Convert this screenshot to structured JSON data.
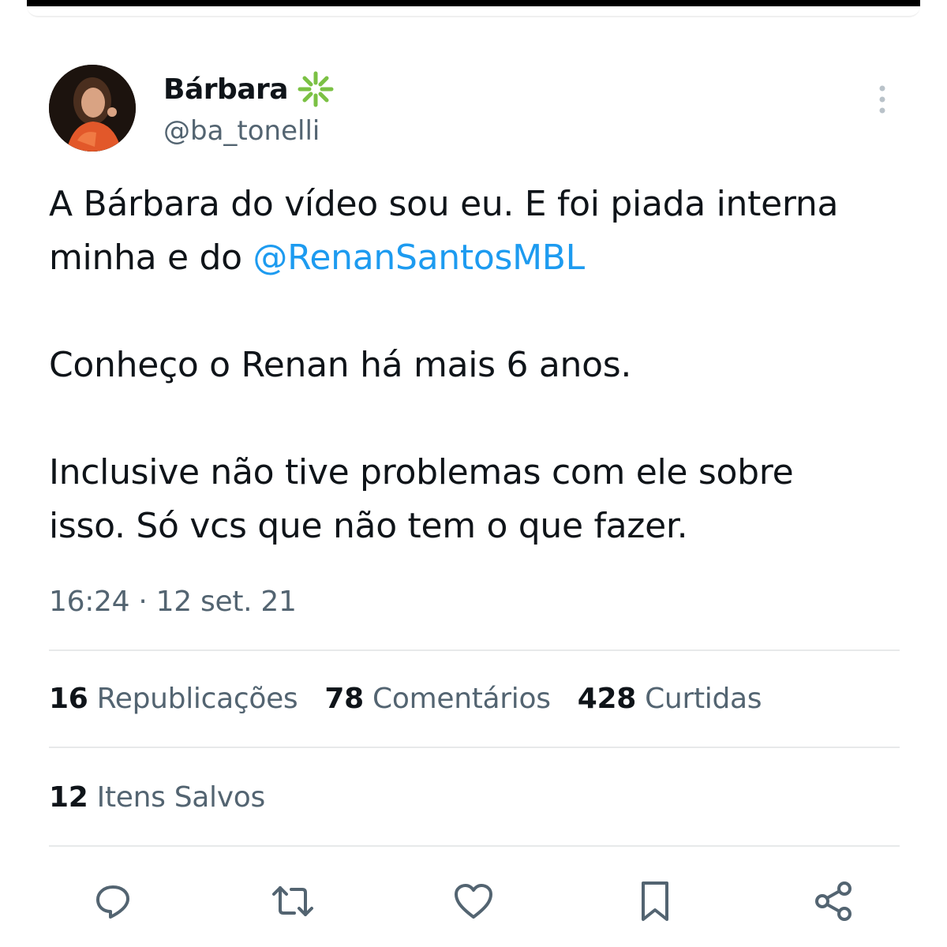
{
  "author": {
    "display_name": "Bárbara",
    "handle": "@ba_tonelli"
  },
  "tweet": {
    "line1_before": "A Bárbara do vídeo sou eu. E foi piada interna\nminha e do ",
    "mention": "@RenanSantosMBL",
    "paragraph2": "Conheço o Renan há mais 6 anos.",
    "paragraph3": "Inclusive não tive problemas com ele sobre\nisso. Só vcs que não tem o que fazer."
  },
  "timestamp": "16:24 · 12 set. 21",
  "stats": {
    "reposts_count": "16",
    "reposts_label": " Republicações",
    "comments_count": "78",
    "comments_label": " Comentários",
    "likes_count": "428",
    "likes_label": " Curtidas",
    "saves_count": "12",
    "saves_label": " Itens Salvos"
  },
  "icons": {
    "verified_badge": "flower-icon",
    "more": "more-vertical-icon",
    "reply": "reply-icon",
    "repost": "repost-icon",
    "like": "heart-icon",
    "bookmark": "bookmark-icon",
    "share": "share-icon"
  },
  "colors": {
    "text": "#0f1419",
    "secondary": "#536471",
    "mention": "#1d9bf0",
    "badge": "#7bc144",
    "divider": "#e7e9ea"
  }
}
